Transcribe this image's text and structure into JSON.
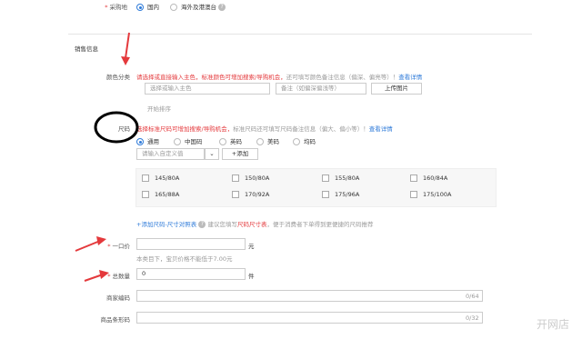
{
  "origin": {
    "label": "采购地",
    "options": [
      "国内",
      "海外及港澳台"
    ],
    "selected": 0
  },
  "sales_section": {
    "title": "销售信息"
  },
  "color": {
    "label": "颜色分类",
    "tip_orange": "请选择或直接输入主色，标准颜色可增加搜索/导购机会，",
    "tip_gray": "还可填写颜色备注信息（偏深、偏亮等）！",
    "tip_link": "查看详情",
    "main_placeholder": "选择或输入主色",
    "note_placeholder": "备注（如偏深偏浅等）",
    "upload_label": "上传图片",
    "start_sort": "开始排序"
  },
  "size": {
    "label": "尺码",
    "tip_orange": "选择标准尺码可增加搜索/导购机会，",
    "tip_gray": "标准尺码还可填写尺码备注信息（偏大、偏小等）！",
    "tip_link": "查看详情",
    "tabs": [
      "通用",
      "中国码",
      "英码",
      "美码",
      "均码"
    ],
    "selected_tab": 0,
    "custom_placeholder": "请输入自定义值",
    "add_label": "+添加",
    "options": [
      "145/80A",
      "150/80A",
      "155/80A",
      "160/84A",
      "165/88A",
      "170/92A",
      "175/96A",
      "175/100A"
    ],
    "chart_link": "+添加尺码-尺寸对照表",
    "chart_tip_a": "建议您填写",
    "chart_tip_b": "尺码尺寸表",
    "chart_tip_c": "，便于消费者下单得到更便捷的尺码推荐"
  },
  "price": {
    "label": "一口价",
    "value": "",
    "unit": "元",
    "hint": "本类目下，宝贝价格不能低于7.00元"
  },
  "quantity": {
    "label": "总数量",
    "value": "0",
    "unit": "件"
  },
  "merchant_code": {
    "label": "商家编码",
    "counter": "0/64"
  },
  "barcode": {
    "label": "商品条形码",
    "counter": "0/32"
  },
  "watermark": "开网店",
  "annotation_color": "#e4393c",
  "accent_color": "#2f7bd9"
}
